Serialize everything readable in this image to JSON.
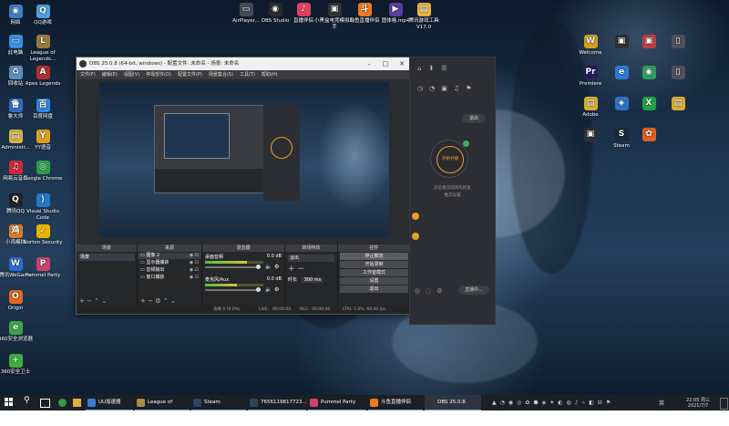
{
  "desktop": {
    "left_icons": [
      {
        "label": "网络",
        "color": "#3d7fc4",
        "glyph": "◉"
      },
      {
        "label": "QQ游戏",
        "color": "#4aa3df",
        "glyph": "Q"
      },
      {
        "label": "此电脑",
        "color": "#3b8ee0",
        "glyph": "▭"
      },
      {
        "label": "League of Legends...",
        "color": "#9a7b3a",
        "glyph": "L"
      },
      {
        "label": "回收站",
        "color": "#5b8fbf",
        "glyph": "♻"
      },
      {
        "label": "Apex Legends",
        "color": "#b03030",
        "glyph": "A"
      },
      {
        "label": "鲁大师",
        "color": "#2f6fc0",
        "glyph": "鲁"
      },
      {
        "label": "百度网盘",
        "color": "#2e86de",
        "glyph": "百"
      },
      {
        "label": "Administr...",
        "color": "#d9b440",
        "glyph": "▤"
      },
      {
        "label": "YY语音",
        "color": "#e0a020",
        "glyph": "Y"
      },
      {
        "label": "网易云音乐",
        "color": "#d0283a",
        "glyph": "♫"
      },
      {
        "label": "Google Chrome",
        "color": "#2f9e48",
        "glyph": "◎"
      },
      {
        "label": "腾讯QQ",
        "color": "#222222",
        "glyph": "Q"
      },
      {
        "label": "Visual Studio Code",
        "color": "#1f7acc",
        "glyph": "⟩"
      },
      {
        "label": "小鸡模拟",
        "color": "#e07a20",
        "glyph": "鸡"
      },
      {
        "label": "Norton Security",
        "color": "#e8b400",
        "glyph": "✓"
      },
      {
        "label": "腾讯WeGame",
        "color": "#2a6dd8",
        "glyph": "W"
      },
      {
        "label": "Pummel Party",
        "color": "#c9436c",
        "glyph": "P"
      },
      {
        "label": "Origin",
        "color": "#e26a1e",
        "glyph": "O"
      },
      {
        "label": "360安全浏览器",
        "color": "#38a845",
        "glyph": "e"
      },
      {
        "label": "360安全卫士",
        "color": "#3cae3c",
        "glyph": "+"
      }
    ],
    "top_icons": [
      {
        "label": "AirPlayer...",
        "color": "#444b55",
        "glyph": "▭"
      },
      {
        "label": "OBS Studio",
        "color": "#2b2b2b",
        "glyph": "◉"
      },
      {
        "label": "直播伴侣",
        "color": "#e04060",
        "glyph": "♪"
      },
      {
        "label": "小黑盒电竞模拟助手",
        "color": "#333333",
        "glyph": "▣"
      },
      {
        "label": "斗鱼直播伴侣",
        "color": "#f07a1a",
        "glyph": "斗"
      },
      {
        "label": "固体格.mp4",
        "color": "#5a3ea0",
        "glyph": "▶"
      },
      {
        "label": "腾讯游戏工具V17.0",
        "color": "#e8b440",
        "glyph": "▤"
      }
    ],
    "right_icons": [
      {
        "label": "Welcome",
        "color": "#d0a020",
        "glyph": "W"
      },
      {
        "label": "",
        "color": "#303030",
        "glyph": "▣"
      },
      {
        "label": "",
        "color": "#c04040",
        "glyph": "▣"
      },
      {
        "label": "",
        "color": "#505058",
        "glyph": "▯"
      },
      {
        "label": "Premiere",
        "color": "#2a1d5a",
        "glyph": "Pr"
      },
      {
        "label": "",
        "color": "#2f7ad0",
        "glyph": "e"
      },
      {
        "label": "",
        "color": "#2e9e58",
        "glyph": "◉"
      },
      {
        "label": "",
        "color": "#505058",
        "glyph": "▯"
      },
      {
        "label": "Adobe",
        "color": "#d8b030",
        "glyph": "▤"
      },
      {
        "label": "",
        "color": "#3070c0",
        "glyph": "◈"
      },
      {
        "label": "",
        "color": "#20a040",
        "glyph": "X"
      },
      {
        "label": "",
        "color": "#d8b030",
        "glyph": "▤"
      },
      {
        "label": "",
        "color": "#303038",
        "glyph": "▣"
      },
      {
        "label": "Steam",
        "color": "#1b2838",
        "glyph": "S"
      },
      {
        "label": "",
        "color": "#e06020",
        "glyph": "✿"
      }
    ]
  },
  "obs": {
    "title": "OBS 25.0.8 (64-bit, windows) - 配置文件: 未命名 - 场景: 未命名",
    "menu": [
      "文件(F)",
      "编辑(E)",
      "视图(V)",
      "停靠部件(D)",
      "配置文件(P)",
      "场景集合(S)",
      "工具(T)",
      "帮助(H)"
    ],
    "docks": {
      "scenes_title": "场景",
      "scene_item": "场景",
      "sources_title": "来源",
      "sources": [
        "图像 2",
        "显示器捕获",
        "音频输出",
        "窗口捕获"
      ],
      "mixer_title": "混音器",
      "mixer_tracks": [
        {
          "name": "桌面音频",
          "level": "0.0 dB",
          "fill": 0.72
        },
        {
          "name": "麦克风/Aux",
          "level": "0.0 dB",
          "fill": 0.55
        }
      ],
      "transitions_title": "转场特效",
      "transition_value": "淡出",
      "duration_label": "时长",
      "duration_value": "300 ms",
      "controls_title": "控件",
      "controls": [
        "停止推流",
        "开始录制",
        "工作室模式",
        "设置",
        "退出"
      ]
    },
    "status": {
      "drop": "丢帧 0 (0.0%)",
      "live_label": "LIVE:",
      "live_time": "00:00:00",
      "rec_label": "REC:",
      "rec_time": "00:00:00",
      "cpu": "CPU: 1.0%, 60.00 fps"
    }
  },
  "right_panel": {
    "exit_label": "退出",
    "start_label": "开始开播",
    "hint_line1": "开启推流前请先检查",
    "hint_line2": "推流设置",
    "side_button": "直播中...",
    "accent": "#e8a020"
  },
  "taskbar": {
    "items": [
      {
        "label": "UU加速器",
        "color": "#3a7cd6"
      },
      {
        "label": "League of Lege...",
        "color": "#b08a40"
      },
      {
        "label": "Steam",
        "color": "#2a475e"
      },
      {
        "label": "7656119817723...",
        "color": "#2a475e"
      },
      {
        "label": "Pummel Party",
        "color": "#c9436c"
      },
      {
        "label": "斗鱼直播伴侣",
        "color": "#f07a1a"
      },
      {
        "label": "OBS 25.0.8 (64-...",
        "color": "#333333"
      }
    ],
    "time": "22:05 周三",
    "date": "2021/7/7",
    "lang": "英"
  }
}
